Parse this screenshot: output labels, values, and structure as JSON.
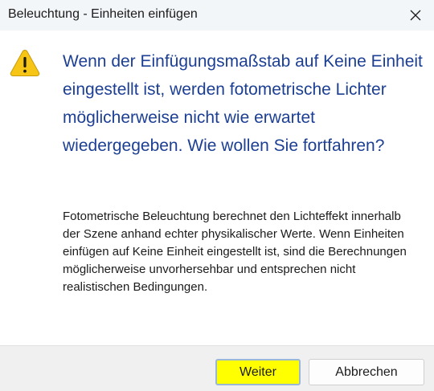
{
  "window": {
    "title": "Beleuchtung - Einheiten einfügen",
    "close_icon": "close-icon"
  },
  "content": {
    "icon": "warning-icon",
    "main_instruction": "Wenn der Einfügungsmaßstab auf Keine Einheit eingestellt ist, werden fotometrische Lichter möglicherweise nicht wie erwartet wiedergegeben. Wie wollen Sie fortfahren?",
    "description": "Fotometrische Beleuchtung berechnet den Lichteffekt innerhalb der Szene anhand echter physikalischer Werte. Wenn Einheiten einfügen auf Keine Einheit eingestellt ist, sind die Berechnungen möglicherweise unvorhersehbar und entsprechen nicht realistischen Bedingungen."
  },
  "buttons": {
    "continue_label": "Weiter",
    "cancel_label": "Abbrechen"
  },
  "colors": {
    "instruction_text": "#1c3f94",
    "warning_fill": "#f7c515",
    "continue_highlight": "#ffff00"
  }
}
